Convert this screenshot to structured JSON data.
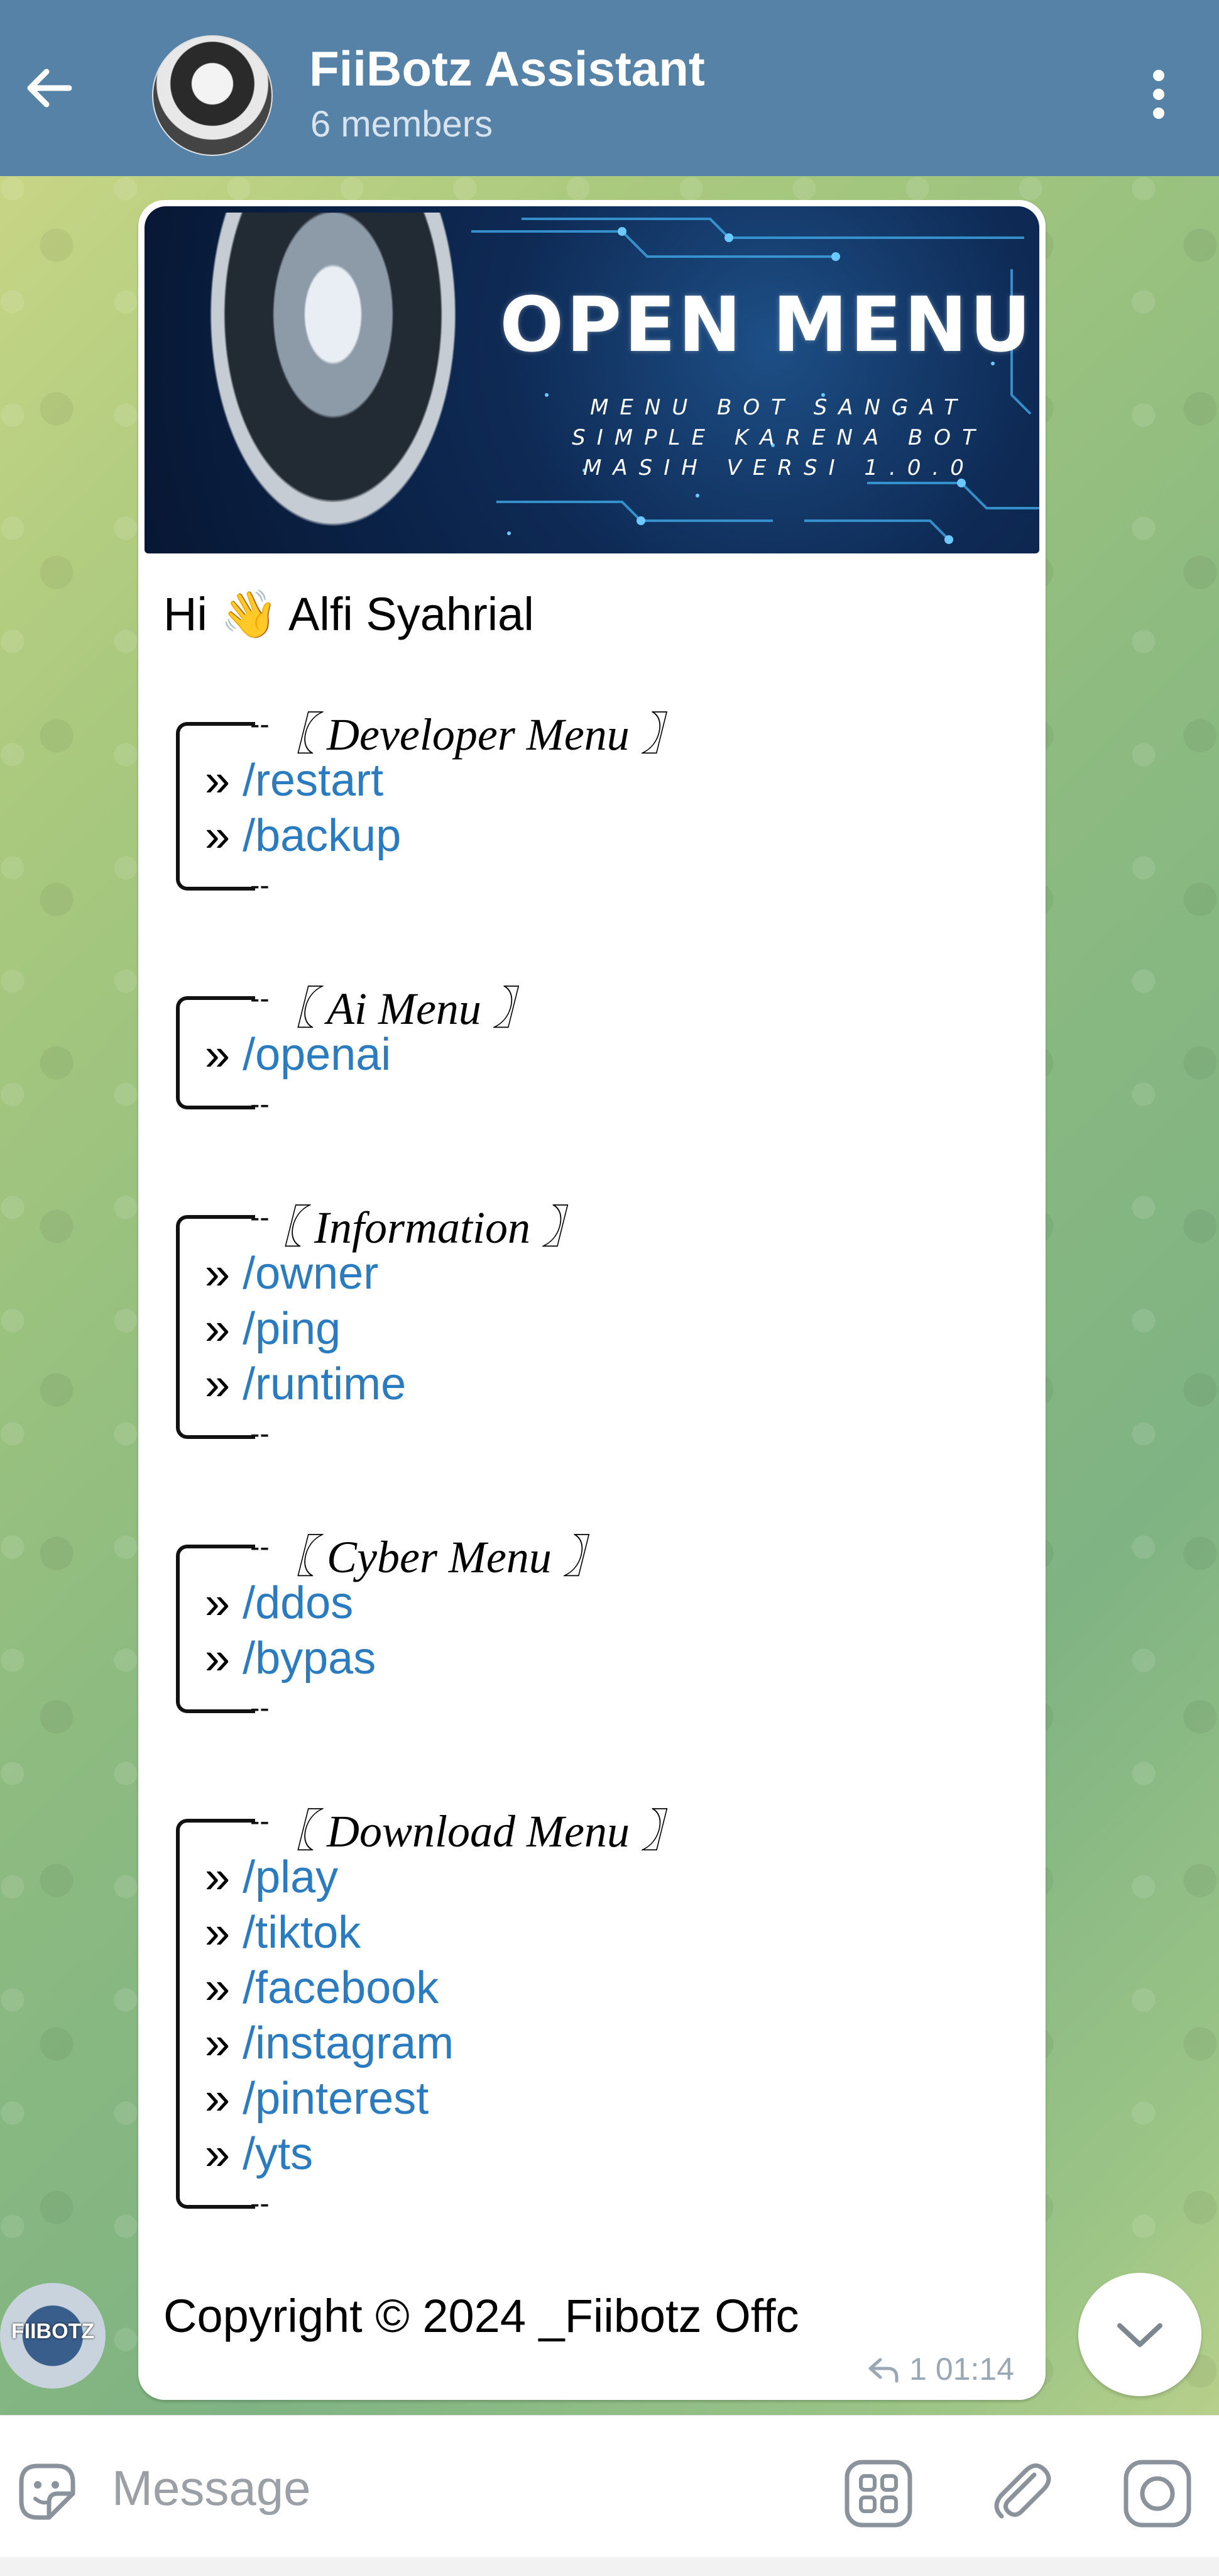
{
  "header": {
    "title": "FiiBotz Assistant",
    "subtitle": "6 members",
    "icons": {
      "back": "arrow-left-icon",
      "menu": "more-vertical-icon"
    }
  },
  "message": {
    "banner": {
      "title": "OPEN MENU",
      "subtitle_lines": [
        "MENU BOT SANGAT",
        "SIMPLE KARENA BOT",
        "MASIH VERSI 1.0.0"
      ]
    },
    "greeting": "Hi 👋 Alfi Syahrial",
    "sections": [
      {
        "title": "〖 Developer Menu 〗",
        "commands": [
          "/restart",
          "/backup"
        ]
      },
      {
        "title": "〖 Ai Menu 〗",
        "commands": [
          "/openai"
        ]
      },
      {
        "title": "〖 Information 〗",
        "commands": [
          "/owner",
          "/ping",
          "/runtime"
        ]
      },
      {
        "title": "〖 Cyber Menu 〗",
        "commands": [
          "/ddos",
          "/bypas"
        ]
      },
      {
        "title": "〖 Download Menu 〗",
        "commands": [
          "/play",
          "/tiktok",
          "/facebook",
          "/instagram",
          "/pinterest",
          "/yts"
        ]
      }
    ],
    "bullet": "»",
    "copyright": "Copyright © 2024 _Fiibotz Offc",
    "reply_count": "1",
    "time": "01:14"
  },
  "bot_avatar_label": "FIIBOTZ",
  "input": {
    "placeholder": "Message",
    "icons": [
      "sticker-icon",
      "bot-commands-icon",
      "attach-icon",
      "camera-icon"
    ]
  },
  "colors": {
    "header": "#5682a8",
    "link": "#2a7bbf",
    "meta": "#9aa7b4"
  }
}
